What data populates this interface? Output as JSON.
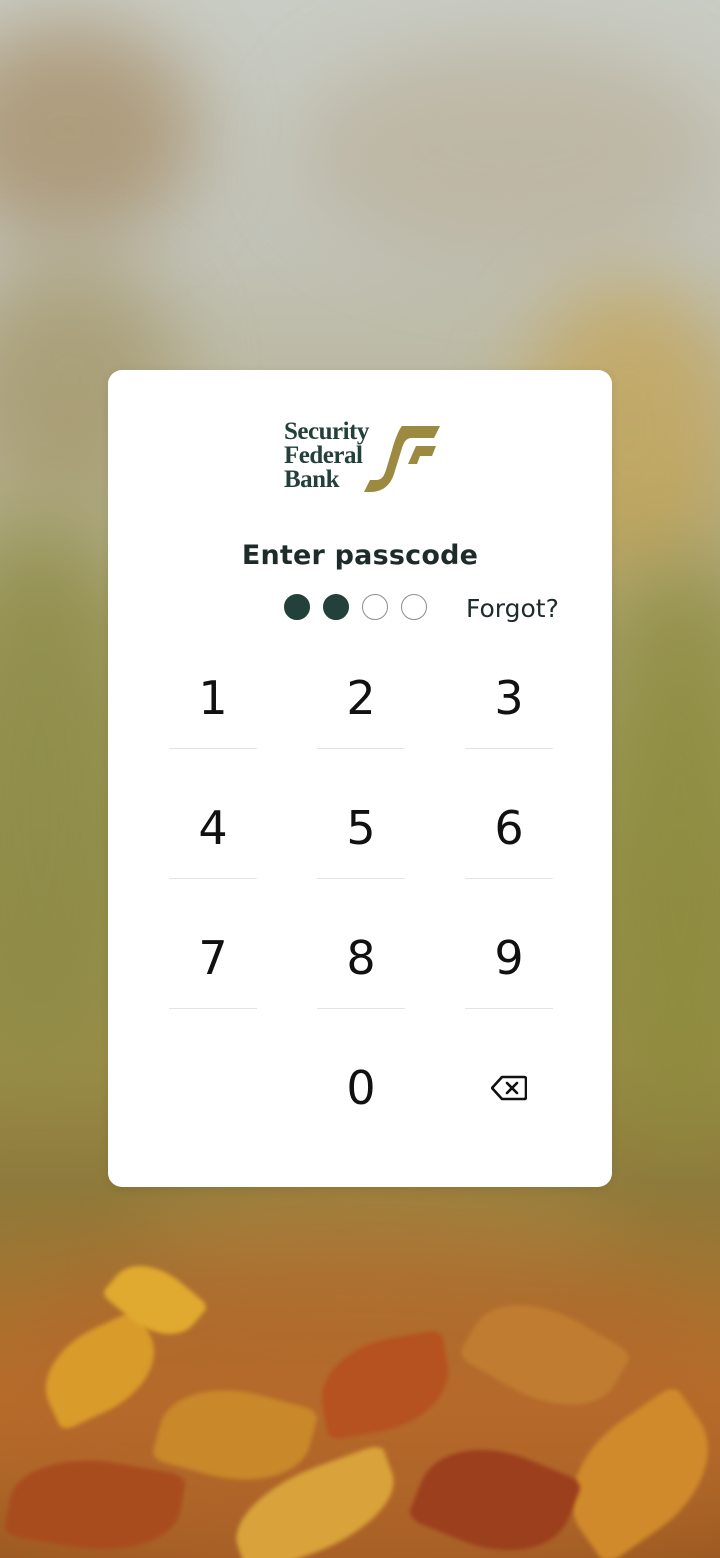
{
  "brand": {
    "logo_lines": [
      "Security",
      "Federal",
      "Bank"
    ],
    "primary_color": "#23413a",
    "accent_color": "#9b8a3f"
  },
  "passcode": {
    "title": "Enter passcode",
    "length": 4,
    "entered": 2,
    "forgot_label": "Forgot?"
  },
  "keypad": {
    "keys": [
      "1",
      "2",
      "3",
      "4",
      "5",
      "6",
      "7",
      "8",
      "9",
      "",
      "0",
      "backspace"
    ],
    "backspace_icon": "backspace-icon"
  }
}
